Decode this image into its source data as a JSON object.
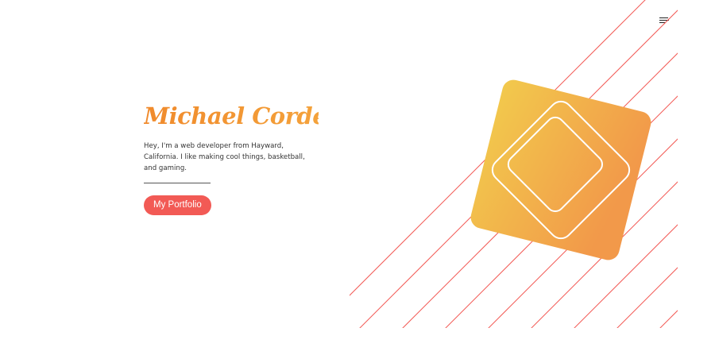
{
  "header": {
    "menu_icon": "hamburger-menu-icon"
  },
  "hero": {
    "name": "Michael Cordero",
    "bio": "Hey, I'm a web developer from Hayward, California. I like making cool things, basketball, and gaming.",
    "cta_label": "My Portfolio"
  },
  "art": {
    "stripe_color": "#f25a55",
    "gradient_start": "#f2c94c",
    "gradient_end": "#f2994a",
    "outline_color": "#ffffff"
  },
  "colors": {
    "accent": "#f25a55",
    "name_gradient_start": "#f08a2c",
    "name_gradient_end": "#f4a23b"
  }
}
